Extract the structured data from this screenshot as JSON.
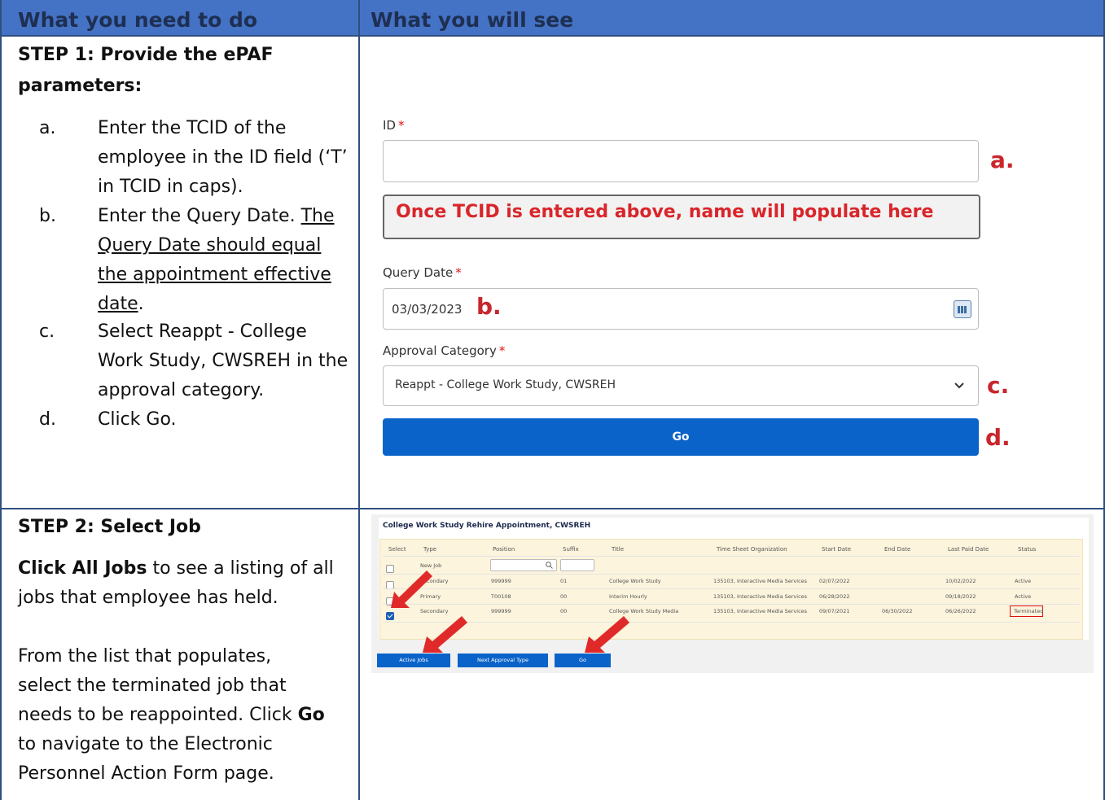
{
  "header": {
    "col1": "What you need to do",
    "col2": "What you will see"
  },
  "step1": {
    "title_line1": "STEP 1: Provide the ePAF",
    "title_line2": "parameters:",
    "items": [
      {
        "marker": "a.",
        "line1": "Enter the TCID of the",
        "line2": "employee in the ID field (‘T’",
        "line3": "in TCID in caps)."
      },
      {
        "marker": "b.",
        "line1": "Enter the Query Date.",
        "u1": "The",
        "u2": "Query Date should equal",
        "u3": "the appointment effective",
        "u4": "date",
        "after": "."
      },
      {
        "marker": "c.",
        "line1": "Select Reappt - College",
        "line2": "Work Study, CWSREH in the",
        "line3": "approval category."
      },
      {
        "marker": "d.",
        "line1": "Click Go."
      }
    ],
    "form": {
      "id_label": "ID",
      "required_mark": "*",
      "name_placeholder": "Once TCID is entered above, name will populate here",
      "query_date_label": "Query Date",
      "query_date_value": "03/03/2023",
      "approval_label": "Approval Category",
      "approval_value": "Reappt - College Work Study, CWSREH",
      "go_label": "Go",
      "annotations": {
        "a": "a.",
        "b": "b.",
        "c": "c.",
        "d": "d."
      }
    }
  },
  "step2": {
    "title": "STEP 2: Select Job",
    "p1_bold": "Click All Jobs",
    "p1_line1": " to see a listing of all",
    "p1_line2": "jobs that employee has held.",
    "p2_line1": "From the list that populates,",
    "p2_line2": "select the terminated job that",
    "p2_line3a": "needs to be reappointed. Click ",
    "p2_bold": "Go",
    "p2_line4": "to navigate to the Electronic",
    "p2_line5": "Personnel Action Form page.",
    "panel_title": "College Work Study Rehire Appointment, CWSREH",
    "columns": [
      "Select",
      "Type",
      "Position",
      "Suffix",
      "Title",
      "Time Sheet Organization",
      "Start Date",
      "End Date",
      "Last Paid Date",
      "Status"
    ],
    "new_job_label": "New Job",
    "rows": [
      {
        "type": "Secondary",
        "position": "999999",
        "suffix": "01",
        "title": "College Work Study",
        "org": "135103, Interactive Media Services",
        "start": "02/07/2022",
        "end": "",
        "last_paid": "10/02/2022",
        "status": "Active",
        "checked": false
      },
      {
        "type": "Primary",
        "position": "T00108",
        "suffix": "00",
        "title": "Interim Hourly",
        "org": "135103, Interactive Media Services",
        "start": "06/28/2022",
        "end": "",
        "last_paid": "09/18/2022",
        "status": "Active",
        "checked": false
      },
      {
        "type": "Secondary",
        "position": "999999",
        "suffix": "00",
        "title": "College Work Study Media",
        "org": "135103, Interactive Media Services",
        "start": "09/07/2021",
        "end": "06/30/2022",
        "last_paid": "06/26/2022",
        "status": "Terminated",
        "checked": true
      }
    ],
    "buttons": {
      "active_jobs": "Active Jobs",
      "next_approval": "Next Approval Type",
      "go": "Go"
    }
  },
  "colors": {
    "header_bg": "#4472c4",
    "header_text": "#1e2f52",
    "accent_red": "#c8262c",
    "button_blue": "#0a63c9"
  }
}
